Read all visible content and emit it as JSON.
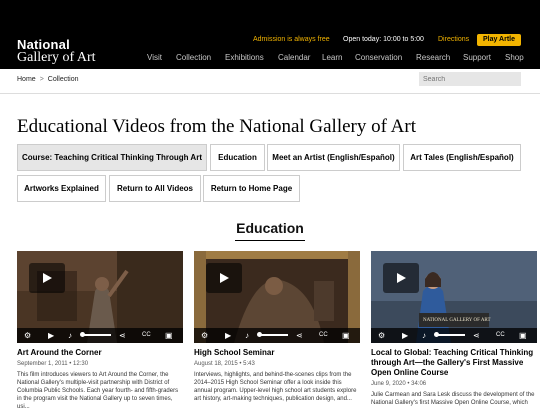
{
  "header": {
    "logo_line1": "National",
    "logo_line2": "Gallery of Art",
    "admission": "Admission is always free",
    "hours": "Open today: 10:00 to 5:00",
    "directions": "Directions",
    "play_button": "Play Artle",
    "nav": [
      "Visit",
      "Collection",
      "Exhibitions",
      "Calendar",
      "Learn",
      "Conservation",
      "Research",
      "Support",
      "Shop"
    ]
  },
  "breadcrumb": {
    "home": "Home",
    "separator": ">",
    "current": "Collection"
  },
  "search": {
    "placeholder": "Search"
  },
  "page_title": "Educational Videos from the National Gallery of Art",
  "tabs": [
    "Course: Teaching Critical Thinking Through Art",
    "Education",
    "Meet an Artist (English/Español)",
    "Art Tales (English/Español)",
    "Artworks Explained",
    "Return to All Videos",
    "Return to Home Page"
  ],
  "section_title": "Education",
  "cards": [
    {
      "title": "Art Around the Corner",
      "meta": "September 1, 2011 • 12:30",
      "description": "This film introduces viewers to Art Around the Corner, the National Gallery's multiple-visit partnership with District of Columbia Public Schools. Each year fourth- and fifth-graders in the program visit the National Gallery up to seven times, usi..."
    },
    {
      "title": "High School Seminar",
      "meta": "August 18, 2015 • 5:43",
      "description": "Interviews, highlights, and behind-the-scenes clips from the 2014–2015 High School Seminar offer a look inside this annual program. Upper-level high school art students explore art history, art-making techniques, publication design, and..."
    },
    {
      "title": "Local to Global: Teaching Critical Thinking through Art—the Gallery's First Massive Open Online Course",
      "meta": "June 9, 2020 • 34:06",
      "description": "Julie Carmean and Sara Lesk discuss the development of the National Gallery's first Massive Open Online Course, which",
      "podium_text": "NATIONAL GALLERY OF ART"
    }
  ],
  "player": {
    "settings_icon": "gear-icon",
    "play_icon": "play-icon",
    "volume_icon": "volume-icon",
    "share_icon": "share-icon",
    "captions_label": "CC",
    "pip_icon": "pip-icon"
  },
  "colors": {
    "header_bg": "#000000",
    "accent_yellow": "#f2b400",
    "active_tab_bg": "#e6e6e6"
  }
}
